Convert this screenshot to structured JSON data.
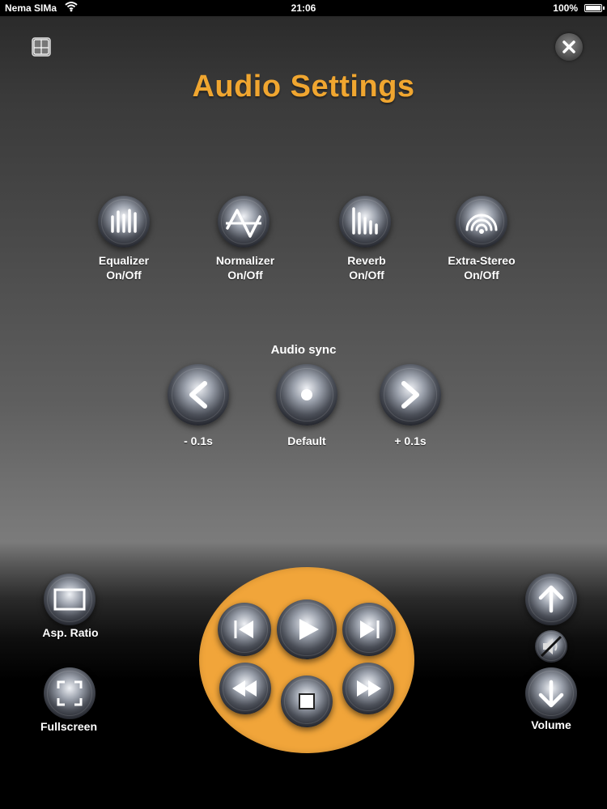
{
  "status_bar": {
    "carrier": "Nema SIMa",
    "time": "21:06",
    "battery": "100%"
  },
  "title": "Audio Settings",
  "effects": [
    {
      "name": "Equalizer",
      "sub": "On/Off",
      "icon": "equalizer-bars-icon"
    },
    {
      "name": "Normalizer",
      "sub": "On/Off",
      "icon": "normalizer-wave-icon"
    },
    {
      "name": "Reverb",
      "sub": "On/Off",
      "icon": "reverb-bars-icon"
    },
    {
      "name": "Extra-Stereo",
      "sub": "On/Off",
      "icon": "stereo-arcs-icon"
    }
  ],
  "audio_sync": {
    "title": "Audio sync",
    "minus_label": "- 0.1s",
    "default_label": "Default",
    "plus_label": "+ 0.1s"
  },
  "bottom": {
    "aspect_ratio_label": "Asp. Ratio",
    "fullscreen_label": "Fullscreen",
    "volume_label": "Volume"
  },
  "colors": {
    "title": "#f0a630",
    "player_pad": "#f1a53a"
  }
}
